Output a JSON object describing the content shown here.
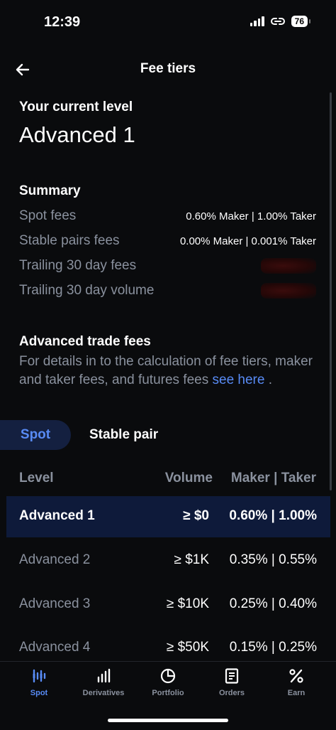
{
  "status_bar": {
    "time": "12:39",
    "battery": "76"
  },
  "header": {
    "title": "Fee tiers"
  },
  "current_level": {
    "label": "Your current level",
    "value": "Advanced 1"
  },
  "summary": {
    "title": "Summary",
    "rows": [
      {
        "label": "Spot fees",
        "value": "0.60% Maker | 1.00% Taker"
      },
      {
        "label": "Stable pairs fees",
        "value": "0.00% Maker | 0.001% Taker"
      },
      {
        "label": "Trailing 30 day fees",
        "value": ""
      },
      {
        "label": "Trailing 30 day volume",
        "value": ""
      }
    ]
  },
  "advanced": {
    "title": "Advanced trade fees",
    "description": "For details in to the calculation of fee tiers, maker and taker fees, and futures fees ",
    "link": "see here",
    "suffix": " ."
  },
  "tabs": {
    "spot": "Spot",
    "stable": "Stable pair"
  },
  "table": {
    "headers": {
      "level": "Level",
      "volume": "Volume",
      "fees": "Maker | Taker"
    },
    "rows": [
      {
        "level": "Advanced 1",
        "volume": "≥ $0",
        "fees": "0.60% | 1.00%"
      },
      {
        "level": "Advanced 2",
        "volume": "≥ $1K",
        "fees": "0.35% | 0.55%"
      },
      {
        "level": "Advanced 3",
        "volume": "≥ $10K",
        "fees": "0.25% | 0.40%"
      },
      {
        "level": "Advanced 4",
        "volume": "≥ $50K",
        "fees": "0.15% | 0.25%"
      }
    ]
  },
  "bottom_nav": {
    "items": [
      {
        "label": "Spot",
        "icon": "spot-icon"
      },
      {
        "label": "Derivatives",
        "icon": "bar-chart-icon"
      },
      {
        "label": "Portfolio",
        "icon": "pie-chart-icon"
      },
      {
        "label": "Orders",
        "icon": "document-icon"
      },
      {
        "label": "Earn",
        "icon": "percent-icon"
      }
    ]
  },
  "colors": {
    "background": "#0a0b0d",
    "accent": "#588bf5",
    "muted": "#8a919e",
    "highlight_row": "#0e1a3a"
  }
}
